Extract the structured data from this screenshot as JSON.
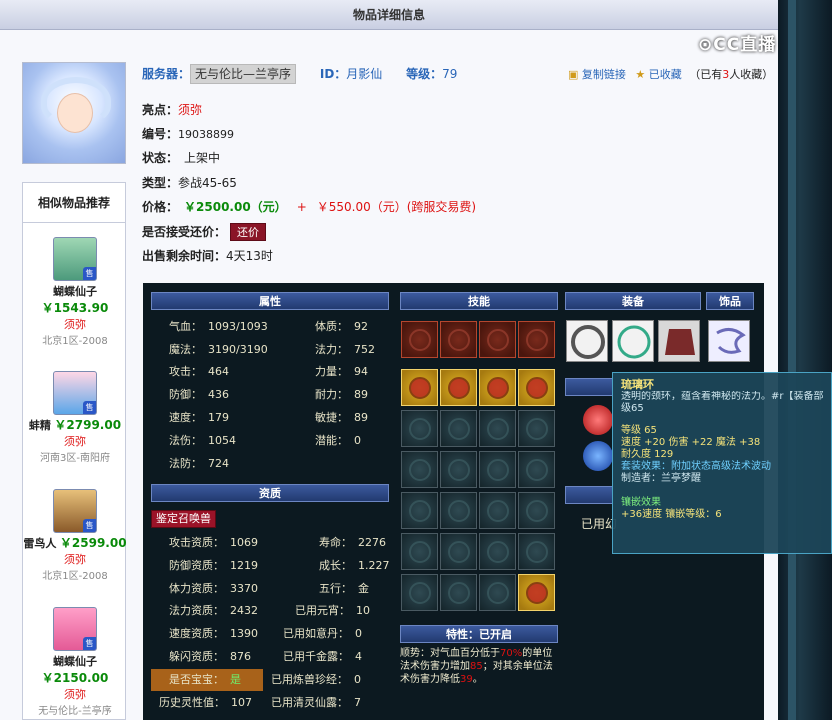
{
  "page": {
    "title": "物品详细信息",
    "watermark": "CC直播"
  },
  "header": {
    "server_label": "服务器：",
    "server_value": "无与伦比—兰亭序",
    "id_label": "ID：",
    "id_value": "月影仙",
    "level_label": "等级：",
    "level_value": "79",
    "copy_link": "复制链接",
    "favorite": "已收藏",
    "favorite_count_prefix": "（已有",
    "favorite_count": "3",
    "favorite_count_suffix": "人收藏）"
  },
  "info": {
    "highlight_label": "亮点：",
    "highlight_value": "须弥",
    "number_label": "编号：",
    "number_value": "19038899",
    "status_label": "状态：",
    "status_value": "上架中",
    "type_label": "类型：",
    "type_value": "参战45-65",
    "price_label": "价格：",
    "price_main": "￥2500.00（元）",
    "price_plus": "+",
    "price_cross": "￥550.00（元）(跨服交易费)",
    "counter_label": "是否接受还价：",
    "counter_button": "还价",
    "time_label": "出售剩余时间：",
    "time_value": "4天13时"
  },
  "similar": {
    "title": "相似物品推荐",
    "items": [
      {
        "name": "蝴蝶仙子",
        "price": "￥1543.90",
        "tag": "须弥",
        "loc": "北京1区-2008",
        "sell": "售"
      },
      {
        "name": "蚌精",
        "price": "￥2799.00",
        "tag": "须弥",
        "loc": "河南3区-南阳府",
        "sell": "售"
      },
      {
        "name": "雷鸟人",
        "price": "￥2599.00",
        "tag": "须弥",
        "loc": "北京1区-2008",
        "sell": "售"
      },
      {
        "name": "蝴蝶仙子",
        "price": "￥2150.00",
        "tag": "须弥",
        "loc": "无与伦比-兰亭序",
        "sell": "售"
      }
    ]
  },
  "panel": {
    "sections": {
      "attr": "属性",
      "skills": "技能",
      "equip": "装备",
      "accessory": "饰品",
      "aptitude": "资质",
      "trait": "特性：已开启"
    },
    "attrs_left": [
      {
        "k": "气血：",
        "v": "1093/1093"
      },
      {
        "k": "魔法：",
        "v": "3190/3190"
      },
      {
        "k": "攻击：",
        "v": "464"
      },
      {
        "k": "防御：",
        "v": "436"
      },
      {
        "k": "速度：",
        "v": "179"
      },
      {
        "k": "法伤：",
        "v": "1054"
      },
      {
        "k": "法防：",
        "v": "724"
      }
    ],
    "attrs_right": [
      {
        "k": "体质：",
        "v": "92"
      },
      {
        "k": "法力：",
        "v": "752"
      },
      {
        "k": "力量：",
        "v": "94"
      },
      {
        "k": "耐力：",
        "v": "89"
      },
      {
        "k": "敏捷：",
        "v": "89"
      },
      {
        "k": "潜能：",
        "v": "0"
      }
    ],
    "identify_button": "鉴定召唤兽",
    "apt_left": [
      {
        "k": "攻击资质：",
        "v": "1069"
      },
      {
        "k": "防御资质：",
        "v": "1219"
      },
      {
        "k": "体力资质：",
        "v": "3370"
      },
      {
        "k": "法力资质：",
        "v": "2432"
      },
      {
        "k": "速度资质：",
        "v": "1390"
      },
      {
        "k": "躲闪资质：",
        "v": "876"
      },
      {
        "k": "是否宝宝：",
        "v": "是"
      },
      {
        "k": "历史灵性值：",
        "v": "107"
      }
    ],
    "apt_right": [
      {
        "k": "寿命：",
        "v": "2276"
      },
      {
        "k": "成长：",
        "v": "1.227"
      },
      {
        "k": "五行：",
        "v": "金"
      },
      {
        "k": "已用元宵：",
        "v": "10"
      },
      {
        "k": "已用如意丹：",
        "v": "0"
      },
      {
        "k": "已用千金露：",
        "v": "4"
      },
      {
        "k": "已用炼兽珍经：",
        "v": "0"
      },
      {
        "k": "已用清灵仙露：",
        "v": "7"
      }
    ],
    "trait_text_1": "顺势：对气血百分低于",
    "trait_pct1": "70%",
    "trait_text_2": "的单位法术伤害力增加",
    "trait_pct2": "85",
    "trait_text_3": "；对其余单位法术伤害力降低",
    "trait_pct3": "39",
    "trait_text_4": "。",
    "equip_side_label": "已用幻",
    "tooltip": {
      "name": "琉璃环",
      "desc": "透明的颈环，蕴含着神秘的法力。#r【装备部位】",
      "desc2": "级65",
      "level": "等级 65",
      "stats1": "速度 +20 伤害 +22 魔法 +38",
      "durability": "耐久度 129",
      "set": "套装效果：附加状态高级法术波动",
      "maker": "制造者：兰亭梦醒",
      "inlay_title": "镶嵌效果",
      "inlay": "+36速度 镶嵌等级：6"
    }
  }
}
